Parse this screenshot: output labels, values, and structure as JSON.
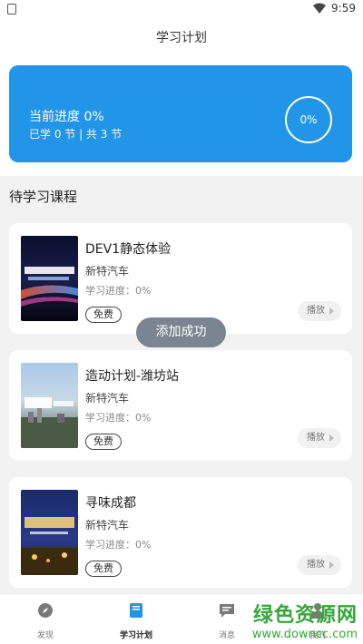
{
  "status_bar": {
    "time": "9:59"
  },
  "header": {
    "title": "学习计划"
  },
  "progress_card": {
    "current": "当前进度 0%",
    "summary": "已学 0 节 | 共 3 节",
    "ring_label": "0%",
    "progress_fraction": 0
  },
  "section": {
    "title": "待学习课程"
  },
  "courses": [
    {
      "title": "DEV1静态体验",
      "author": "新特汽车",
      "progress": "学习进度：0%",
      "badge": "免费",
      "play": "播放"
    },
    {
      "title": "造动计划-潍坊站",
      "author": "新特汽车",
      "progress": "学习进度：0%",
      "badge": "免费",
      "play": "播放"
    },
    {
      "title": "寻味成都",
      "author": "新特汽车",
      "progress": "学习进度：0%",
      "badge": "免费",
      "play": "播放"
    }
  ],
  "toast": {
    "text": "添加成功"
  },
  "tabs": [
    {
      "label": "发现",
      "icon": "compass-icon"
    },
    {
      "label": "学习计划",
      "icon": "book-icon"
    },
    {
      "label": "消息",
      "icon": "chat-icon"
    },
    {
      "label": "我的",
      "icon": "user-icon"
    }
  ],
  "watermark": {
    "line1": "绿色资源网",
    "line2": "www.downcc.com"
  },
  "colors": {
    "accent": "#2196e8",
    "watermark": "#35a83a"
  }
}
